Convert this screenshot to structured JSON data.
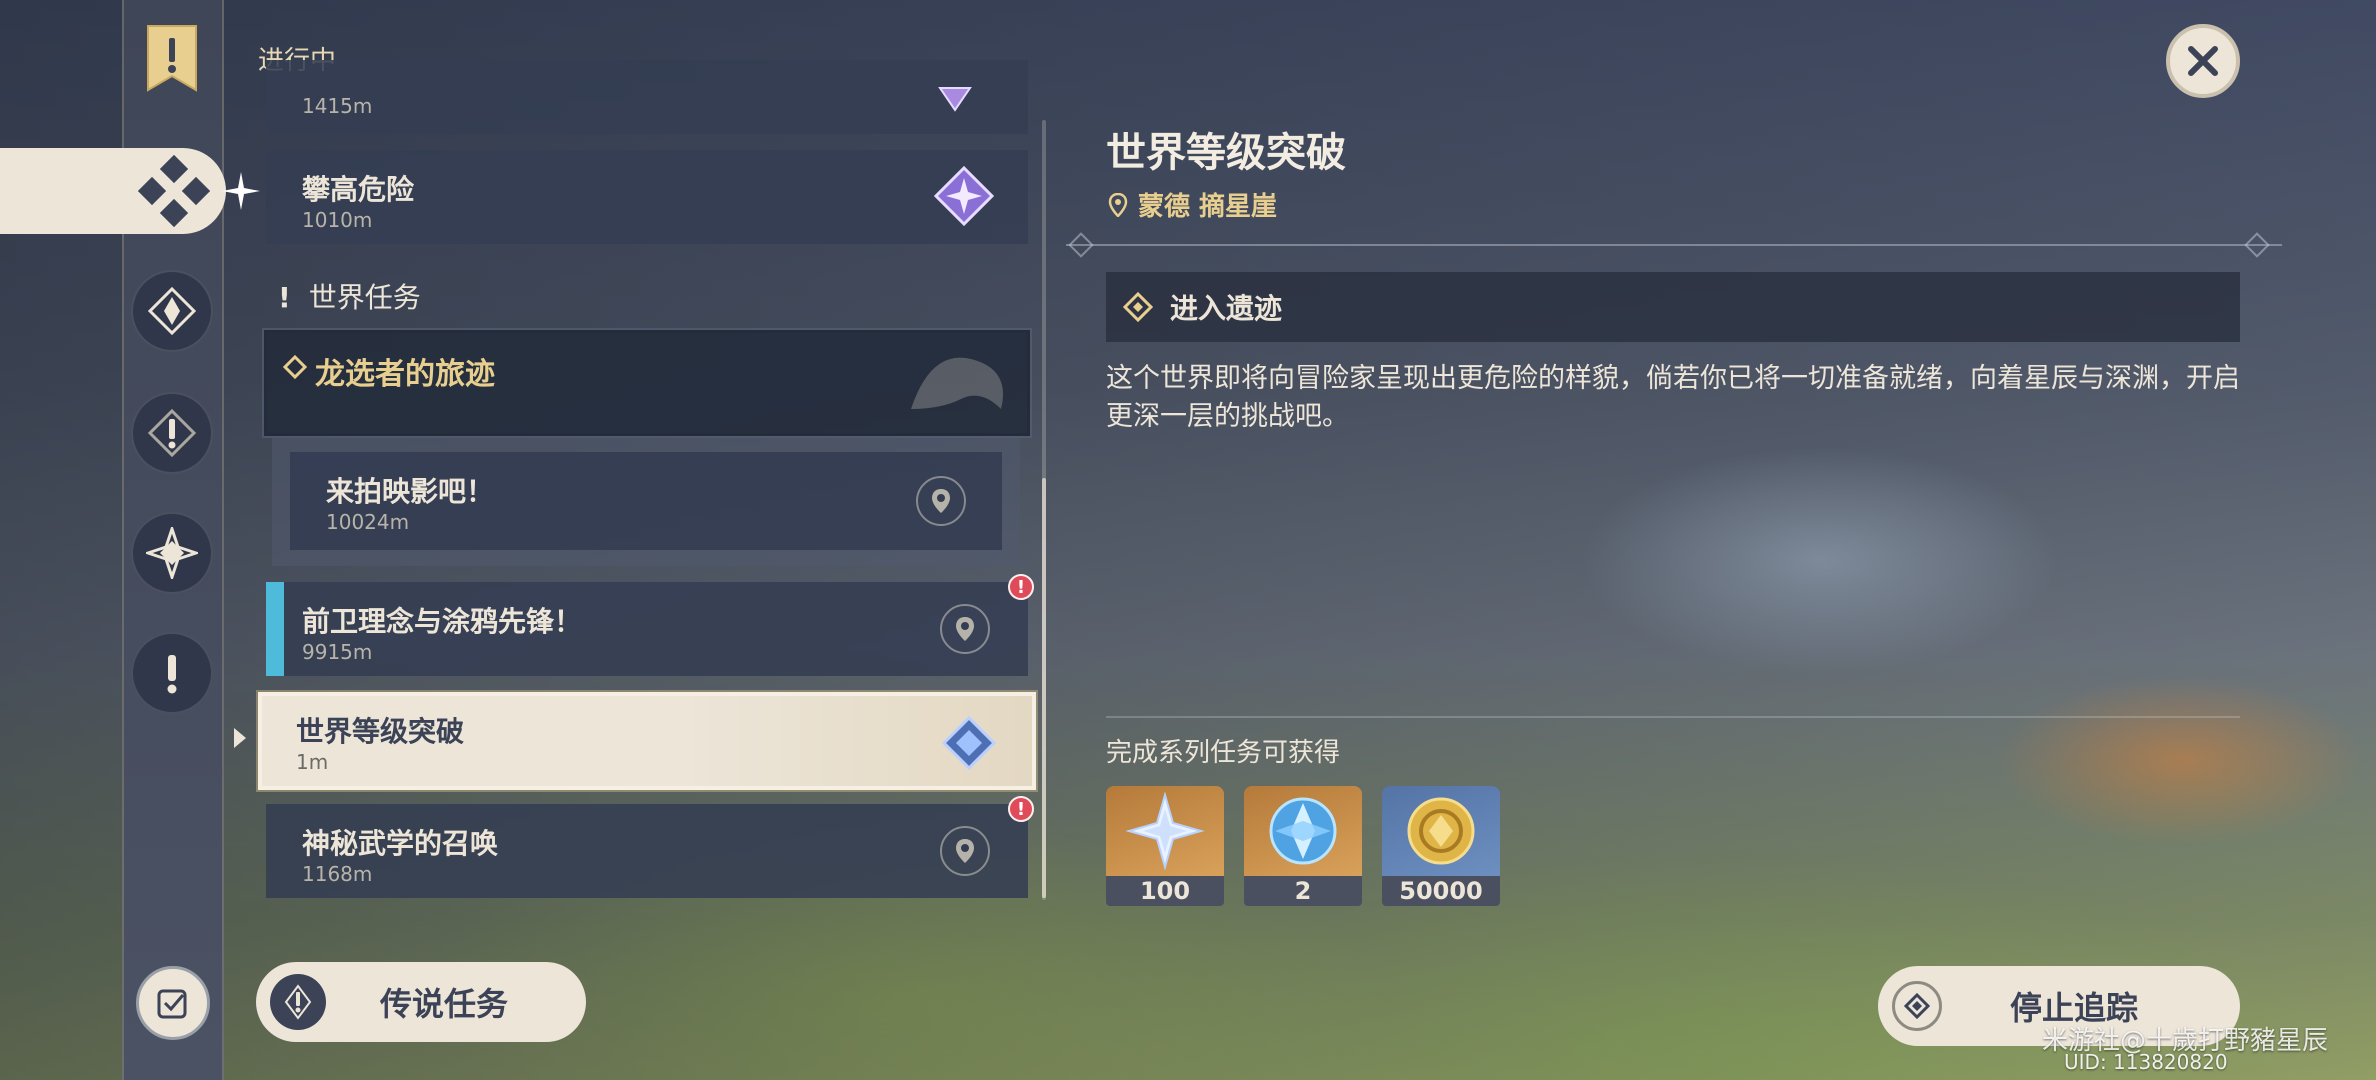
{
  "header": {
    "section_label": "进行中"
  },
  "rail": {
    "icons": [
      "quest-banner-icon",
      "quest-tracker-icon",
      "archon-quest-icon",
      "story-quest-icon",
      "hangout-icon",
      "world-quest-icon",
      "quest-settings-icon"
    ]
  },
  "quest_list": {
    "top_partial": {
      "distance": "1415m"
    },
    "top_card": {
      "title": "攀高危险",
      "distance": "1010m"
    },
    "group_header": "世界任务",
    "story_group": {
      "title": "龙选者的旅迹"
    },
    "sub_card": {
      "title": "来拍映影吧！",
      "distance": "10024m"
    },
    "items": [
      {
        "title": "前卫理念与涂鸦先锋！",
        "distance": "9915m",
        "badge": "!"
      },
      {
        "title": "世界等级突破",
        "distance": "1m"
      },
      {
        "title": "神秘武学的召唤",
        "distance": "1168m",
        "badge": "!"
      }
    ]
  },
  "legend_button": {
    "label": "传说任务"
  },
  "detail": {
    "title": "世界等级突破",
    "location": "蒙德 摘星崖",
    "objective": "进入遗迹",
    "description": "这个世界即将向冒险家呈现出更危险的样貌，倘若你已将一切准备就绪，向着星辰与深渊，开启更深一层的挑战吧。",
    "rewards_title": "完成系列任务可获得",
    "rewards": [
      {
        "icon": "primogem-icon",
        "count": "100"
      },
      {
        "icon": "heros-wit-icon",
        "count": "2"
      },
      {
        "icon": "mora-icon",
        "count": "50000"
      }
    ]
  },
  "stop_button": {
    "label": "停止追踪"
  },
  "watermark": {
    "text": "米游社@十歲打野豬星辰",
    "uid": "UID: 113820820"
  },
  "colors": {
    "accent_gold": "#e8cf8f",
    "cream": "#ece5d8",
    "card_dark": "#343d52",
    "alert_red": "#e04b59",
    "cyan": "#4dbbd9"
  }
}
